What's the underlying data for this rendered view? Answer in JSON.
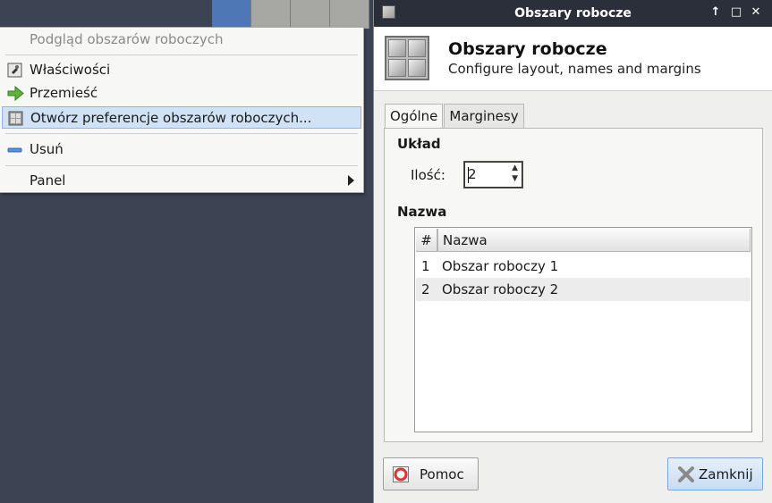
{
  "pager": {
    "workspaces": [
      "1",
      "2",
      "3",
      "4"
    ],
    "active_index": 0
  },
  "menu": {
    "title": "Podgląd obszarów roboczych",
    "items": [
      {
        "label": "Właściwości",
        "icon": "properties-icon"
      },
      {
        "label": "Przemieść",
        "icon": "move-arrow-icon"
      },
      {
        "label": "Otwórz preferencje obszarów roboczych...",
        "icon": "workspaces-icon",
        "highlighted": true
      },
      {
        "label": "Usuń",
        "icon": "remove-icon"
      },
      {
        "label": "Panel",
        "icon": "",
        "submenu": true
      }
    ]
  },
  "dialog": {
    "window_title": "Obszary robocze",
    "header_title": "Obszary robocze",
    "header_subtitle": "Configure layout, names and margins",
    "tabs": [
      "Ogólne",
      "Marginesy"
    ],
    "layout_section": "Układ",
    "count_label": "Ilość:",
    "count_value": "2",
    "name_section": "Nazwa",
    "table": {
      "columns": [
        "#",
        "Nazwa"
      ],
      "rows": [
        {
          "num": "1",
          "name": "Obszar roboczy 1"
        },
        {
          "num": "2",
          "name": "Obszar roboczy 2"
        }
      ]
    },
    "help_button": "Pomoc",
    "close_button": "Zamknij"
  },
  "colors": {
    "accent": "#4e77b5",
    "titlebar": "#2b2f3a",
    "desktop": "#3c4353",
    "highlight": "#cfe2f6"
  }
}
